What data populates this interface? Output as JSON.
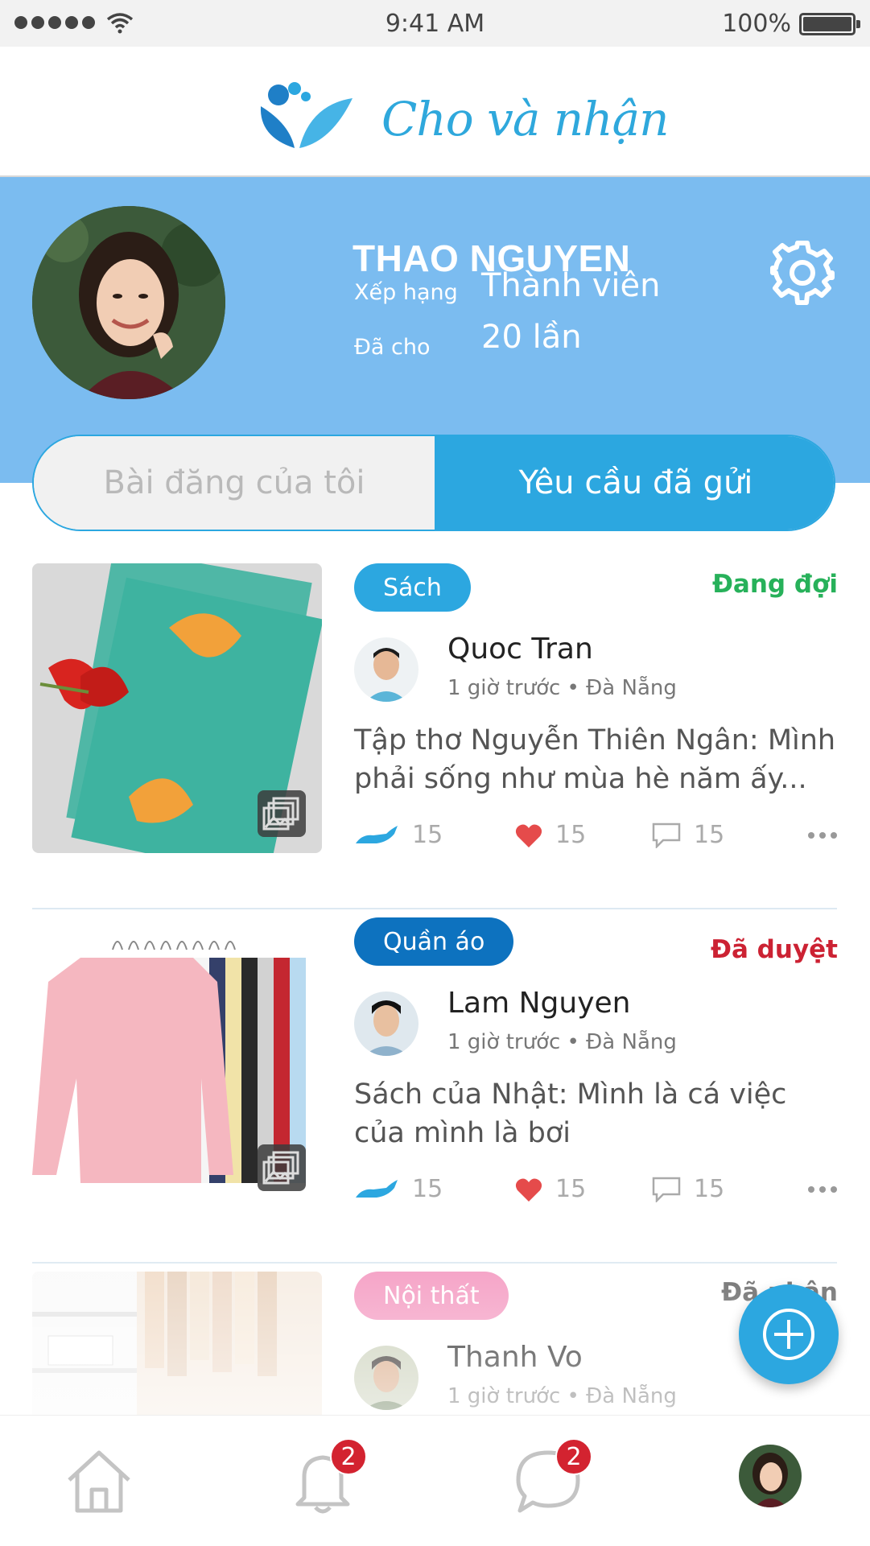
{
  "status_bar": {
    "time": "9:41 AM",
    "battery": "100%"
  },
  "app": {
    "title": "Cho và nhận"
  },
  "profile": {
    "name": "THAO NGUYEN",
    "rank_label": "Xếp hạng",
    "rank_value": "Thành viên",
    "given_label": "Đã cho",
    "given_value": "20 lần"
  },
  "tabs": {
    "my_posts": "Bài đăng của tôi",
    "sent_requests": "Yêu cầu đã gửi",
    "active": "sent_requests"
  },
  "posts": [
    {
      "category": "Sách",
      "category_color": "#2ca7e0",
      "status": "Đang đợi",
      "status_color": "#27b15a",
      "author": "Quoc Tran",
      "time": "1 giờ trước",
      "location": "Đà Nẵng",
      "title": "Tập thơ Nguyễn Thiên Ngân: Mình phải sống như mùa hè năm ấy...",
      "give_count": "15",
      "like_count": "15",
      "comment_count": "15"
    },
    {
      "category": "Quần áo",
      "category_color": "#0d72bf",
      "status": "Đã duyệt",
      "status_color": "#cc2233",
      "author": "Lam Nguyen",
      "time": "1 giờ trước",
      "location": "Đà Nẵng",
      "title": "Sách của Nhật: Mình là cá việc của mình là bơi",
      "give_count": "15",
      "like_count": "15",
      "comment_count": "15"
    },
    {
      "category": "Nội thất",
      "category_color": "#f49ac1",
      "status": "Đã nhận",
      "status_color": "#666666",
      "author": "Thanh Vo",
      "time": "1 giờ trước",
      "location": "Đà Nẵng"
    }
  ],
  "nav": {
    "notification_badge": "2",
    "message_badge": "2"
  },
  "colors": {
    "primary": "#2ca7e0",
    "header_bg": "#7bbcf0",
    "like": "#e54b4b"
  }
}
